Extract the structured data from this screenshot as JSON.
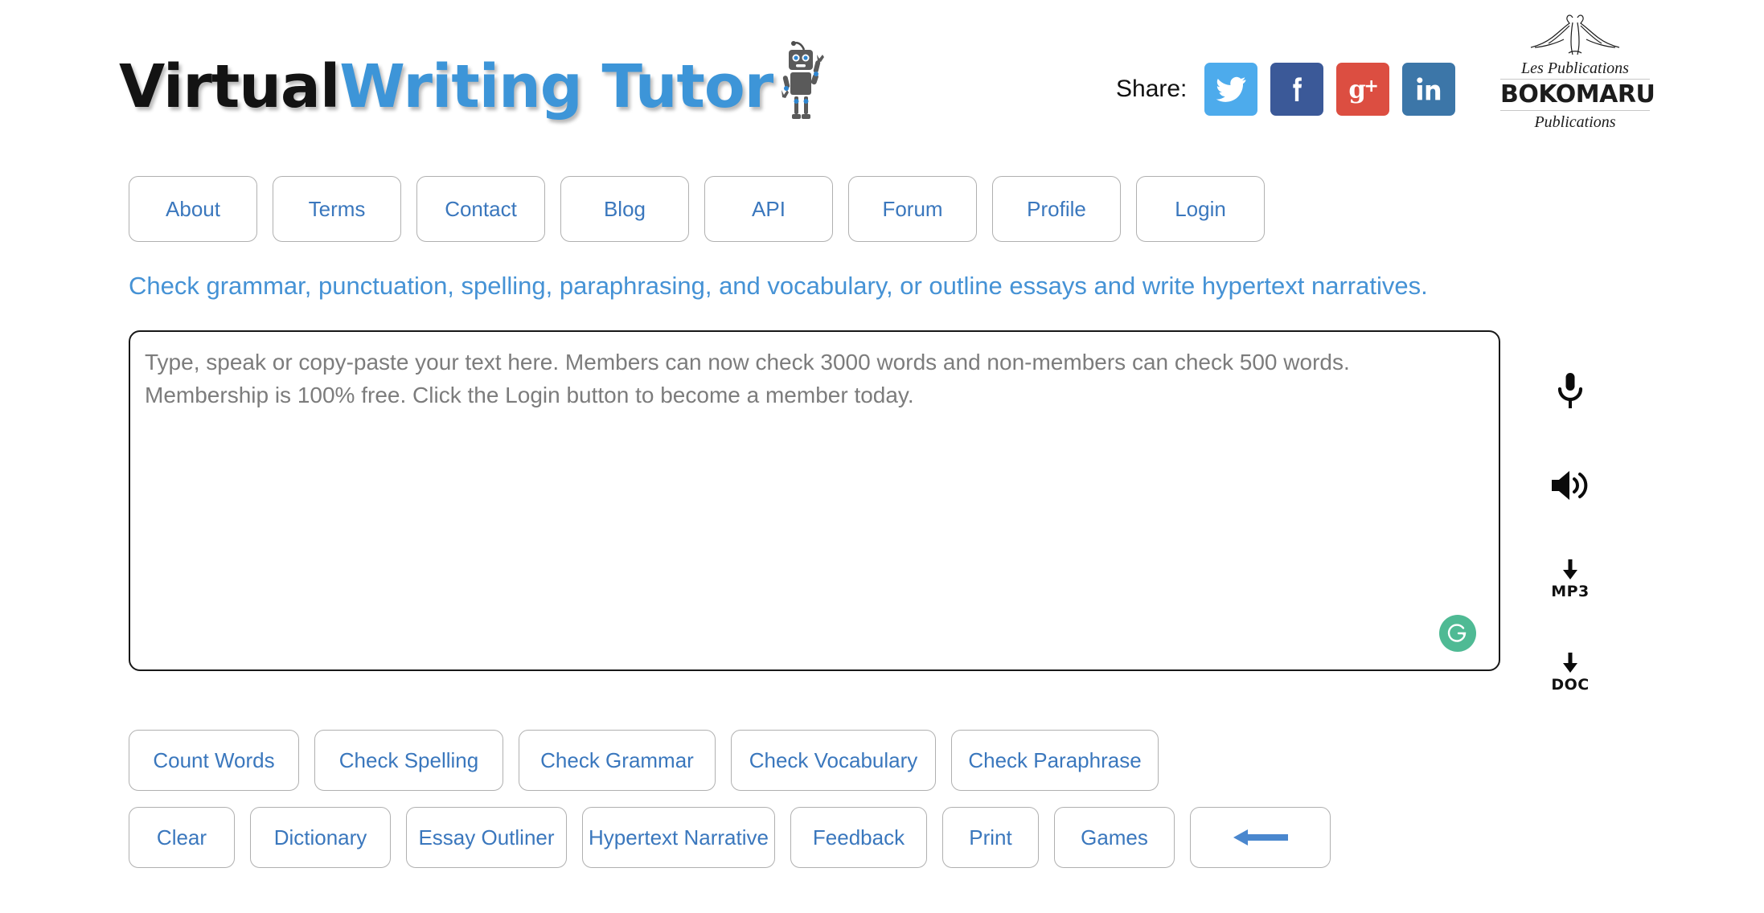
{
  "brand": {
    "logo_first": "Virtual",
    "logo_second": "Writing Tutor",
    "mascot_icon": "robot-icon"
  },
  "share": {
    "label": "Share:",
    "items": [
      {
        "name": "twitter",
        "icon": "twitter-icon",
        "color": "#4dabec",
        "glyph": ""
      },
      {
        "name": "facebook",
        "icon": "facebook-icon",
        "color": "#3b5998",
        "glyph": "f"
      },
      {
        "name": "googleplus",
        "icon": "google-plus-icon",
        "color": "#dc4e41",
        "glyph": "g+"
      },
      {
        "name": "linkedin",
        "icon": "linkedin-icon",
        "color": "#3c76a8",
        "glyph": "in"
      }
    ]
  },
  "publisher": {
    "line1": "Les Publications",
    "line2": "BOKOMARU",
    "line3": "Publications",
    "icon": "bokomaru-figures-icon"
  },
  "nav": {
    "items": [
      {
        "label": "About"
      },
      {
        "label": "Terms"
      },
      {
        "label": "Contact"
      },
      {
        "label": "Blog"
      },
      {
        "label": "API"
      },
      {
        "label": "Forum"
      },
      {
        "label": "Profile"
      },
      {
        "label": "Login"
      }
    ]
  },
  "tagline": "Check grammar, punctuation, spelling, paraphrasing, and vocabulary, or outline essays and write hypertext narratives.",
  "editor": {
    "value": "",
    "placeholder": "Type, speak or copy-paste your text here. Members can now check 3000 words and non-members can check 500 words. Membership is 100% free. Click the Login button to become a member today.",
    "grammarly_badge": {
      "icon": "grammarly-icon",
      "glyph": "G",
      "color": "#4fba94"
    }
  },
  "side_tools": [
    {
      "name": "microphone",
      "icon": "microphone-icon",
      "caption": ""
    },
    {
      "name": "speaker",
      "icon": "speaker-icon",
      "caption": ""
    },
    {
      "name": "download-mp3",
      "icon": "download-arrow-icon",
      "caption": "MP3"
    },
    {
      "name": "download-doc",
      "icon": "download-arrow-icon",
      "caption": "DOC"
    }
  ],
  "actions": {
    "row1": [
      {
        "label": "Count Words",
        "cls": "w-count"
      },
      {
        "label": "Check Spelling",
        "cls": "w-spell"
      },
      {
        "label": "Check Grammar",
        "cls": "w-gram"
      },
      {
        "label": "Check Vocabulary",
        "cls": "w-vocab"
      },
      {
        "label": "Check Paraphrase",
        "cls": "w-para"
      }
    ],
    "row2": [
      {
        "label": "Clear",
        "cls": "w-clear"
      },
      {
        "label": "Dictionary",
        "cls": "w-dict"
      },
      {
        "label": "Essay Outliner",
        "cls": "w-essay"
      },
      {
        "label": "Hypertext Narrative",
        "cls": "w-hyper"
      },
      {
        "label": "Feedback",
        "cls": "w-feed"
      },
      {
        "label": "Print",
        "cls": "w-print"
      },
      {
        "label": "Games",
        "cls": "w-games"
      },
      {
        "label": "←",
        "cls": "w-back",
        "icon": "back-arrow-icon"
      }
    ]
  },
  "colors": {
    "link_blue": "#3a77bd",
    "tagline_blue": "#4592d5",
    "logo_blue": "#3d95d8",
    "border_gray": "#b0b0b0"
  }
}
